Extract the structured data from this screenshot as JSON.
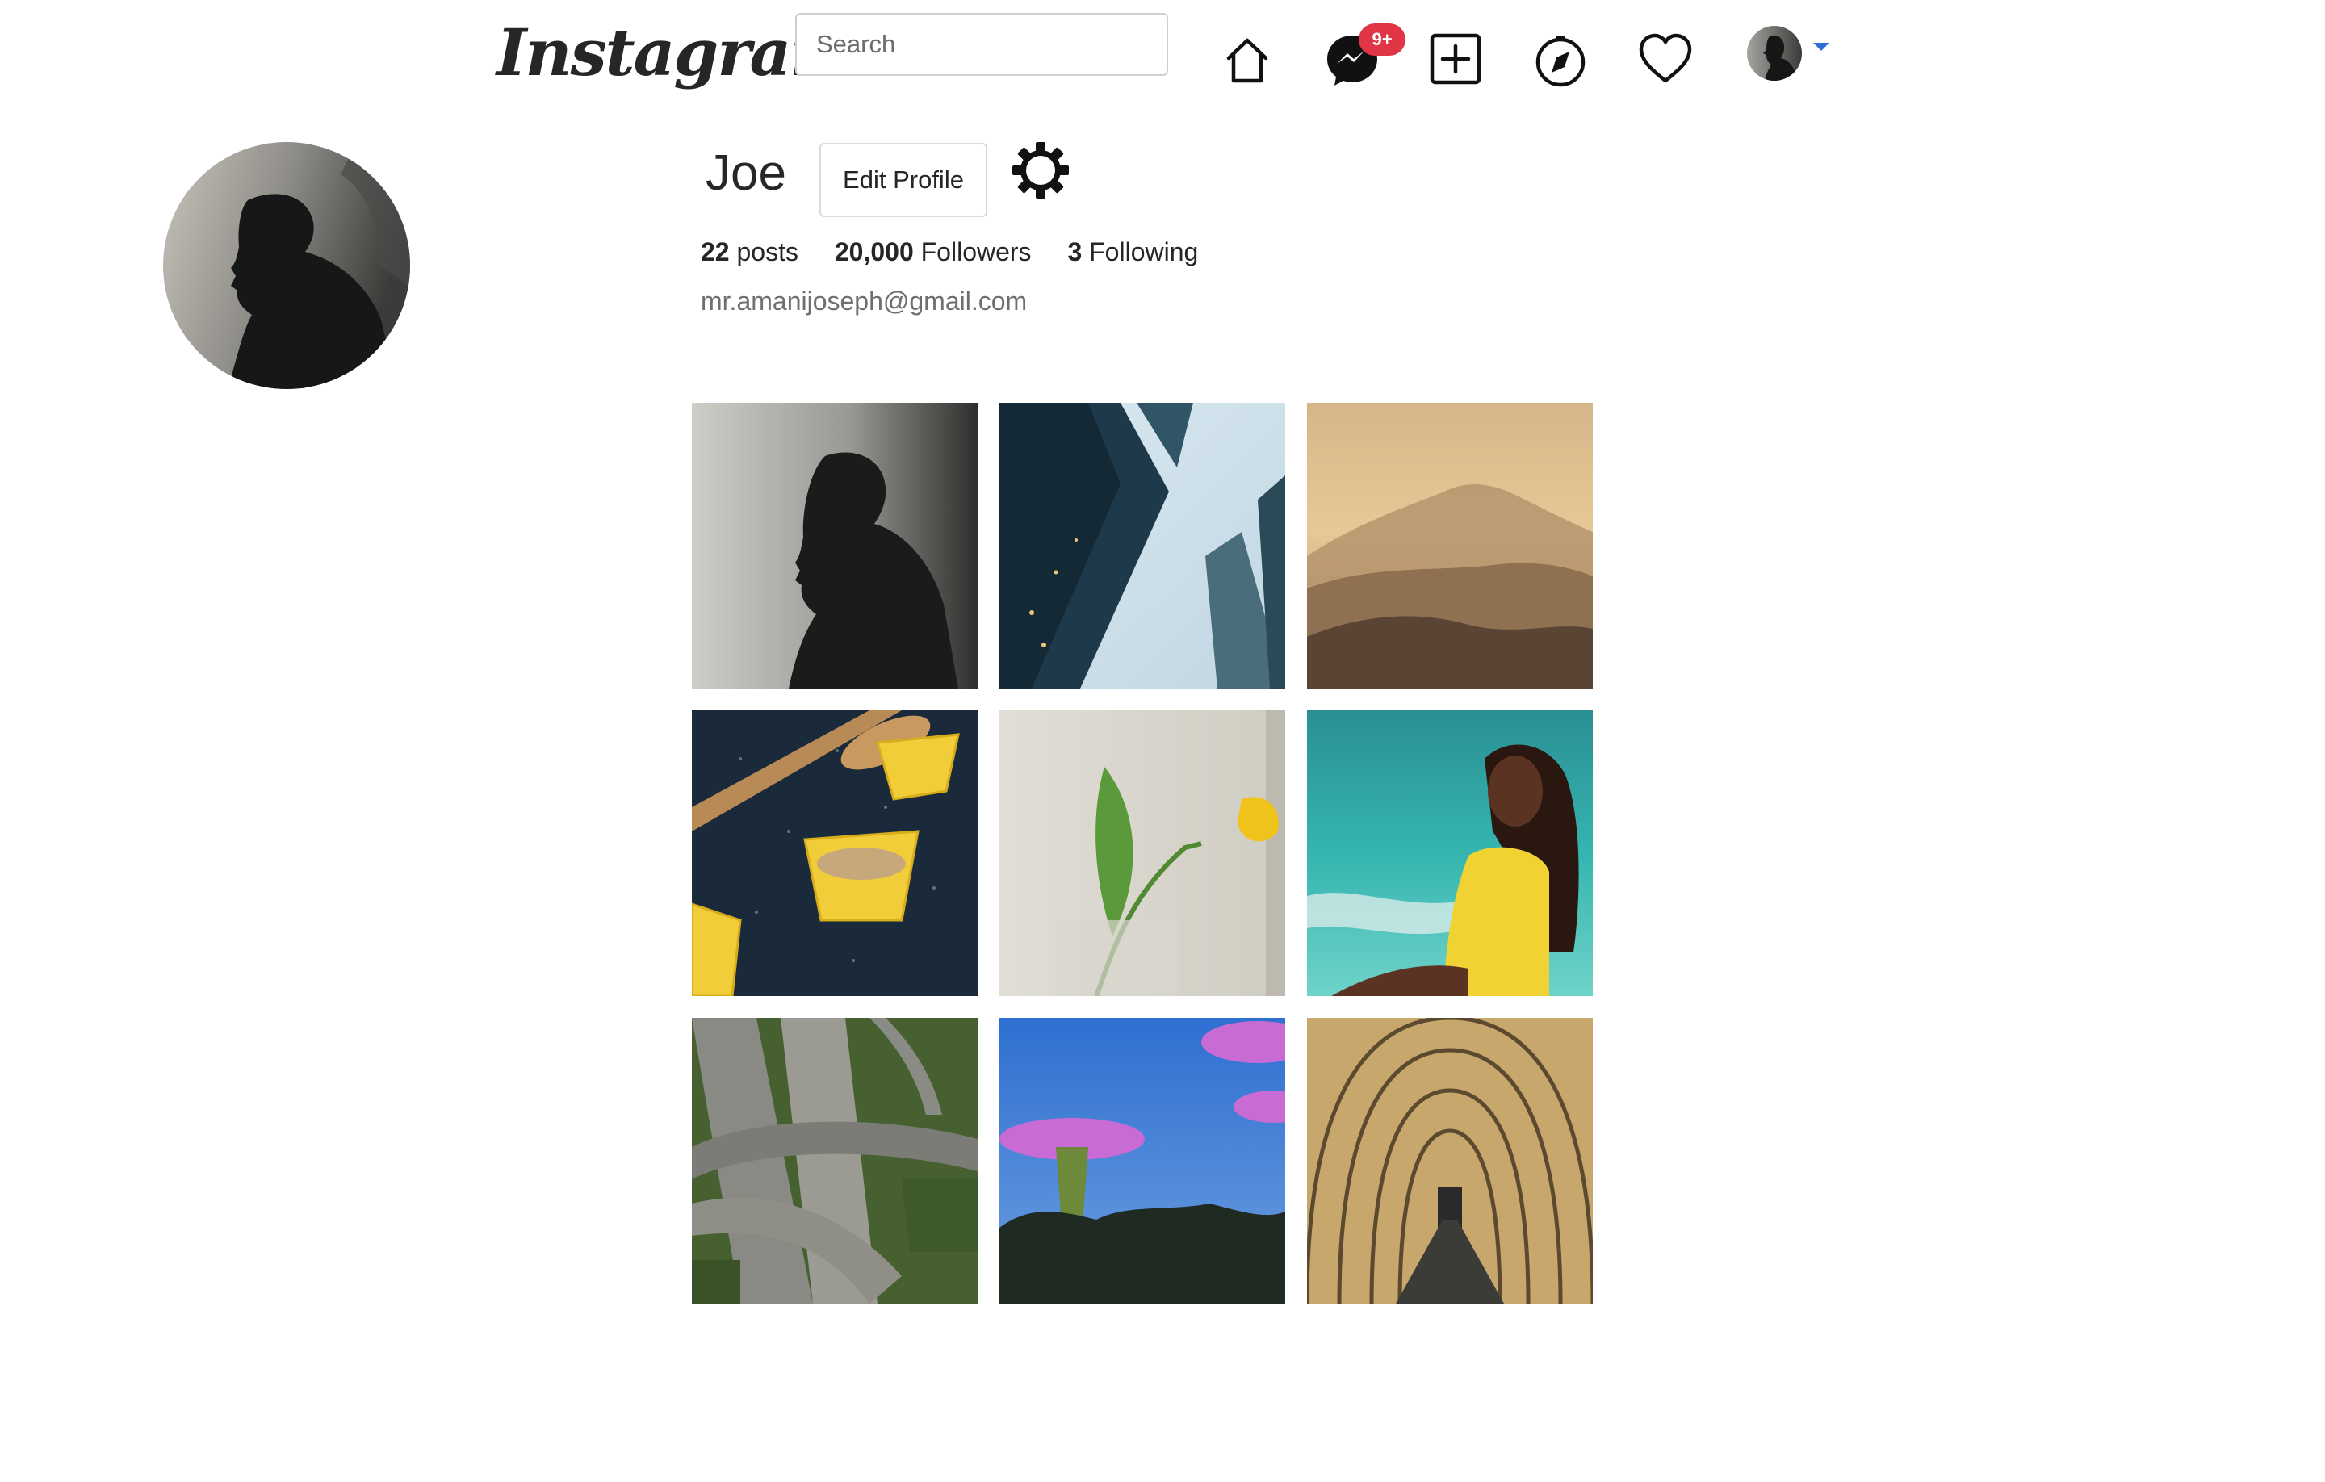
{
  "header": {
    "logo_text": "Instagram",
    "search_placeholder": "Search",
    "messages_badge": "9+",
    "icons": [
      "home-icon",
      "messenger-icon",
      "new-post-icon",
      "explore-icon",
      "activity-heart-icon",
      "profile-avatar",
      "dropdown-caret-icon"
    ],
    "accent_color": "#2d6fd6",
    "badge_color": "#e03545"
  },
  "profile": {
    "username": "Joe",
    "edit_profile_label": "Edit Profile",
    "posts_count": "22",
    "posts_label": "posts",
    "followers_count": "20,000",
    "followers_label": "Followers",
    "following_count": "3",
    "following_label": "Following",
    "email": "mr.amanijoseph@gmail.com"
  },
  "posts": [
    "silhouette-portrait",
    "glass-skyscrapers",
    "misty-mountain",
    "cupcake-liners",
    "yellow-tulip",
    "woman-at-beach",
    "highway-interchange",
    "supertree-grove",
    "covered-walkway"
  ]
}
